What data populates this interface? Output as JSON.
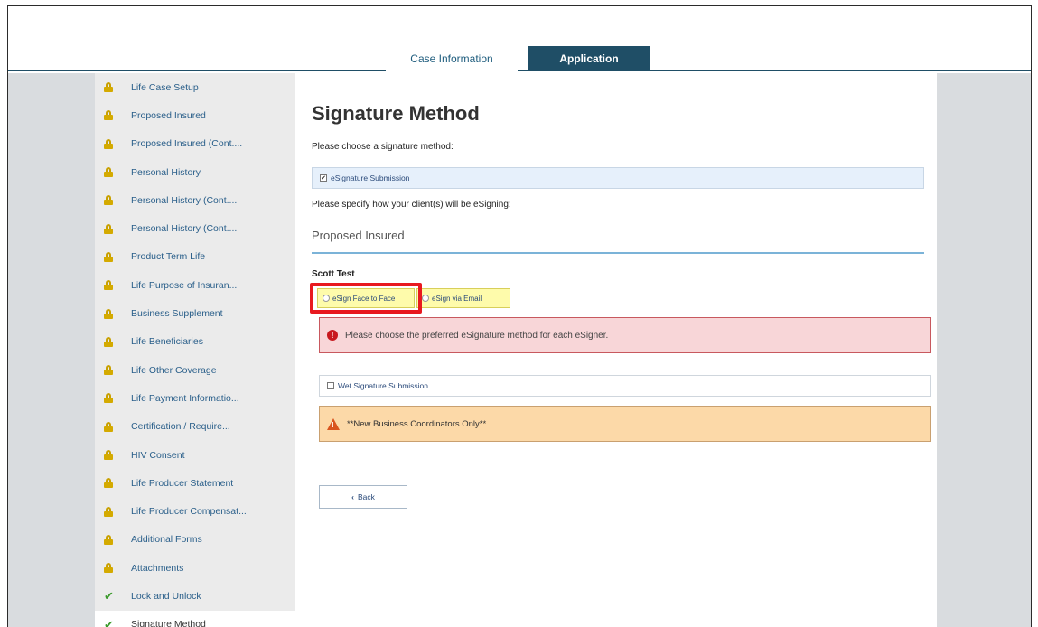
{
  "tabs": [
    {
      "label": "Case Information"
    },
    {
      "label": "Application"
    }
  ],
  "sidebar": {
    "items": [
      {
        "label": "Life Case Setup",
        "icon": "lock-icon"
      },
      {
        "label": "Proposed Insured",
        "icon": "lock-icon"
      },
      {
        "label": "Proposed Insured (Cont....",
        "icon": "lock-icon"
      },
      {
        "label": "Personal History",
        "icon": "lock-icon"
      },
      {
        "label": "Personal History (Cont....",
        "icon": "lock-icon"
      },
      {
        "label": "Personal History (Cont....",
        "icon": "lock-icon"
      },
      {
        "label": "Product Term Life",
        "icon": "lock-icon"
      },
      {
        "label": "Life Purpose of Insuran...",
        "icon": "lock-icon"
      },
      {
        "label": "Business Supplement",
        "icon": "lock-icon"
      },
      {
        "label": "Life Beneficiaries",
        "icon": "lock-icon"
      },
      {
        "label": "Life Other Coverage",
        "icon": "lock-icon"
      },
      {
        "label": "Life Payment Informatio...",
        "icon": "lock-icon"
      },
      {
        "label": "Certification / Require...",
        "icon": "lock-icon"
      },
      {
        "label": "HIV Consent",
        "icon": "lock-icon"
      },
      {
        "label": "Life Producer Statement",
        "icon": "lock-icon"
      },
      {
        "label": "Life Producer Compensat...",
        "icon": "lock-icon"
      },
      {
        "label": "Additional Forms",
        "icon": "lock-icon"
      },
      {
        "label": "Attachments",
        "icon": "lock-icon"
      },
      {
        "label": "Lock and Unlock",
        "icon": "check-icon"
      },
      {
        "label": "Signature Method",
        "icon": "check-icon"
      }
    ]
  },
  "main": {
    "title": "Signature Method",
    "choose_label": "Please choose a signature method:",
    "esignature_option": "eSignature Submission",
    "esignature_checked": true,
    "specify_label": "Please specify how your client(s) will be eSigning:",
    "section_heading": "Proposed Insured",
    "person_name": "Scott Test",
    "radio_face_to_face": "eSign Face to Face",
    "radio_email": "eSign via Email",
    "error_message": "Please choose the preferred eSignature method for each eSigner.",
    "wet_option": "Wet Signature Submission",
    "wet_checked": false,
    "warning_message": "**New Business Coordinators Only**",
    "back_label": "Back"
  },
  "colors": {
    "tab_active": "#1f4e66",
    "highlight": "#e8191f",
    "error_bg": "#f8d6d8",
    "warning_bg": "#fcd9a8"
  }
}
